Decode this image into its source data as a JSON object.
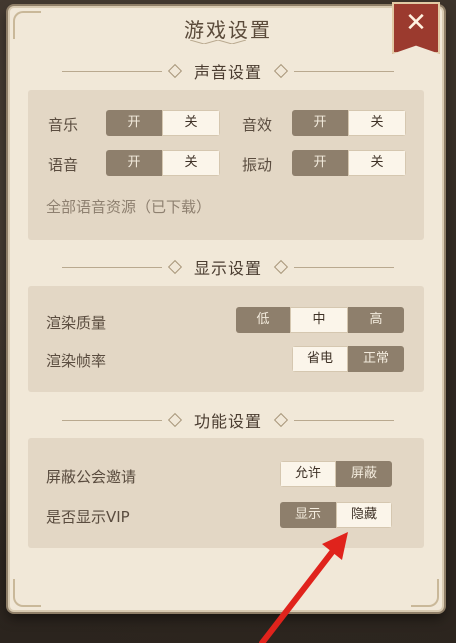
{
  "title": "游戏设置",
  "close_glyph": "✕",
  "sections": {
    "sound": {
      "header": "声音设置",
      "music": {
        "label": "音乐",
        "on": "开",
        "off": "关",
        "selected": "关"
      },
      "sfx": {
        "label": "音效",
        "on": "开",
        "off": "关",
        "selected": "关"
      },
      "voice": {
        "label": "语音",
        "on": "开",
        "off": "关",
        "selected": "关"
      },
      "vibration": {
        "label": "振动",
        "on": "开",
        "off": "关",
        "selected": "关"
      },
      "voice_pack": "全部语音资源（已下载）"
    },
    "display": {
      "header": "显示设置",
      "quality": {
        "label": "渲染质量",
        "options": [
          "低",
          "中",
          "高"
        ],
        "selected": "中"
      },
      "framerate": {
        "label": "渲染帧率",
        "options": [
          "省电",
          "正常"
        ],
        "selected": "省电"
      }
    },
    "function": {
      "header": "功能设置",
      "guild_invite": {
        "label": "屏蔽公会邀请",
        "options": [
          "允许",
          "屏蔽"
        ],
        "selected": "允许"
      },
      "show_vip": {
        "label": "是否显示VIP",
        "options": [
          "显示",
          "隐藏"
        ],
        "selected": "隐藏"
      }
    }
  },
  "colors": {
    "panel": "#f1e8d8",
    "box": "#e3d7c5",
    "toggle_off": "#8e7f6c",
    "toggle_on": "#fbf5ea",
    "close": "#9b3a2e",
    "annotation_arrow": "#e0231c"
  }
}
